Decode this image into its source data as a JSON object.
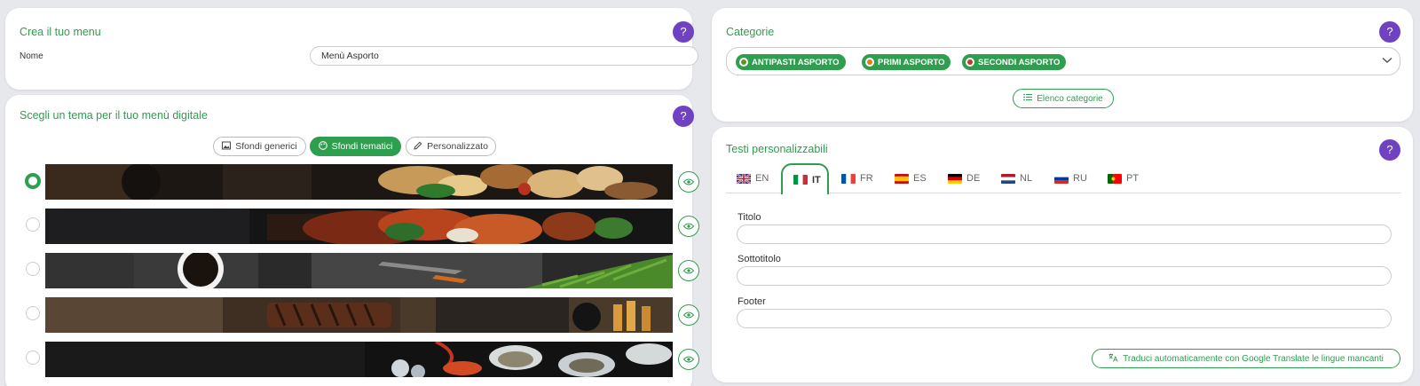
{
  "menu_card": {
    "title": "Crea il tuo menu",
    "name_label": "Nome",
    "name_value": "Menù Asporto",
    "help": "?"
  },
  "theme_card": {
    "title": "Scegli un tema per il tuo menù digitale",
    "help": "?",
    "buttons": [
      {
        "label": "Sfondi generici",
        "icon": "image-icon",
        "active": false
      },
      {
        "label": "Sfondi tematici",
        "icon": "palette-icon",
        "active": true
      },
      {
        "label": "Personalizzato",
        "icon": "pencil-icon",
        "active": false
      }
    ],
    "selected_index": 0
  },
  "categories_card": {
    "title": "Categorie",
    "help": "?",
    "chips": [
      "ANTIPASTI ASPORTO",
      "PRIMI ASPORTO",
      "SECONDI ASPORTO"
    ],
    "list_button": "Elenco categorie"
  },
  "texts_card": {
    "title": "Testi personalizzabili",
    "help": "?",
    "tabs": [
      "EN",
      "IT",
      "FR",
      "ES",
      "DE",
      "NL",
      "RU",
      "PT"
    ],
    "active_tab": "IT",
    "fields": [
      {
        "label": "Titolo",
        "value": ""
      },
      {
        "label": "Sottotitolo",
        "value": ""
      },
      {
        "label": "Footer",
        "value": ""
      }
    ],
    "translate_button": "Traduci automaticamente con Google Translate le lingue mancanti"
  },
  "colors": {
    "accent": "#2e9e4f",
    "help": "#6f42c1"
  }
}
